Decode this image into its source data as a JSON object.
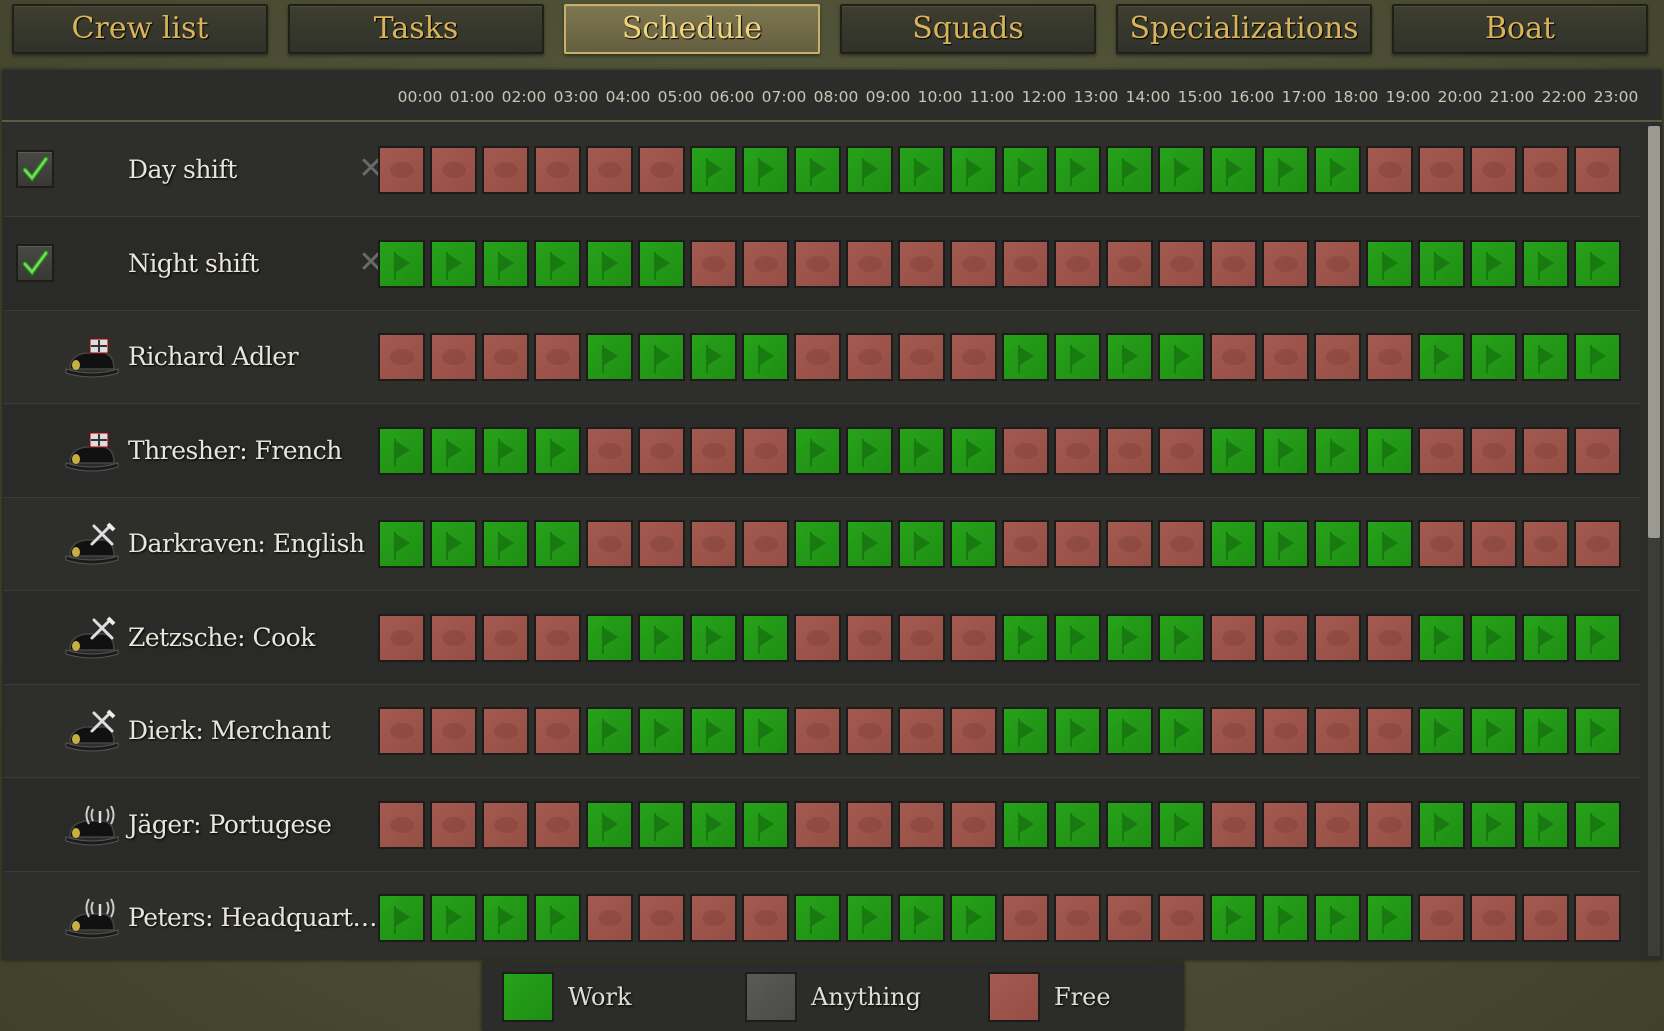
{
  "tabs": [
    {
      "label": "Crew list",
      "active": false
    },
    {
      "label": "Tasks",
      "active": false
    },
    {
      "label": "Schedule",
      "active": true
    },
    {
      "label": "Squads",
      "active": false
    },
    {
      "label": "Specializations",
      "active": false
    },
    {
      "label": "Boat",
      "active": false
    }
  ],
  "hours": [
    "00:00",
    "01:00",
    "02:00",
    "03:00",
    "04:00",
    "05:00",
    "06:00",
    "07:00",
    "08:00",
    "09:00",
    "10:00",
    "11:00",
    "12:00",
    "13:00",
    "14:00",
    "15:00",
    "16:00",
    "17:00",
    "18:00",
    "19:00",
    "20:00",
    "21:00",
    "22:00",
    "23:00"
  ],
  "rows": [
    {
      "label": "Day shift",
      "kind": "template",
      "checked": true,
      "icon": "check-icon",
      "schedule": "FFFFFFWWWWWWWWWWWWWFFFFF"
    },
    {
      "label": "Night shift",
      "kind": "template",
      "checked": true,
      "icon": "check-icon",
      "schedule": "WWWWWWFFFFFFFFFFFFFWWWWW"
    },
    {
      "label": "Richard Adler",
      "kind": "crew",
      "icon": "officer-cap-icon",
      "schedule": "FFFFWWWWFFFFWWWWFFFFWWWW"
    },
    {
      "label": "Thresher: French",
      "kind": "crew",
      "icon": "officer-cap-icon",
      "schedule": "WWWWFFFFWWWWFFFFWWWWFFFF"
    },
    {
      "label": "Darkraven: English",
      "kind": "crew",
      "icon": "sailor-cap-tools-icon",
      "schedule": "WWWWFFFFWWWWFFFFWWWWFFFF"
    },
    {
      "label": "Zetzsche: Cook",
      "kind": "crew",
      "icon": "sailor-cap-tools-icon",
      "schedule": "FFFFWWWWFFFFWWWWFFFFWWWW"
    },
    {
      "label": "Dierk: Merchant",
      "kind": "crew",
      "icon": "sailor-cap-tools-icon",
      "schedule": "FFFFWWWWFFFFWWWWFFFFWWWW"
    },
    {
      "label": "Jäger: Portugese",
      "kind": "crew",
      "icon": "sailor-cap-radio-icon",
      "schedule": "FFFFWWWWFFFFWWWWFFFFWWWW"
    },
    {
      "label": "Peters: Headquart…",
      "kind": "crew",
      "icon": "sailor-cap-radio-icon",
      "schedule": "WWWWFFFFWWWWFFFFWWWWFFFF"
    }
  ],
  "legend": [
    {
      "label": "Work",
      "type": "work"
    },
    {
      "label": "Anything",
      "type": "any"
    },
    {
      "label": "Free",
      "type": "free"
    }
  ],
  "colors": {
    "work": "#27a21a",
    "free": "#a35a50",
    "anything": "#5a5a56",
    "accent": "#d8b35a"
  }
}
